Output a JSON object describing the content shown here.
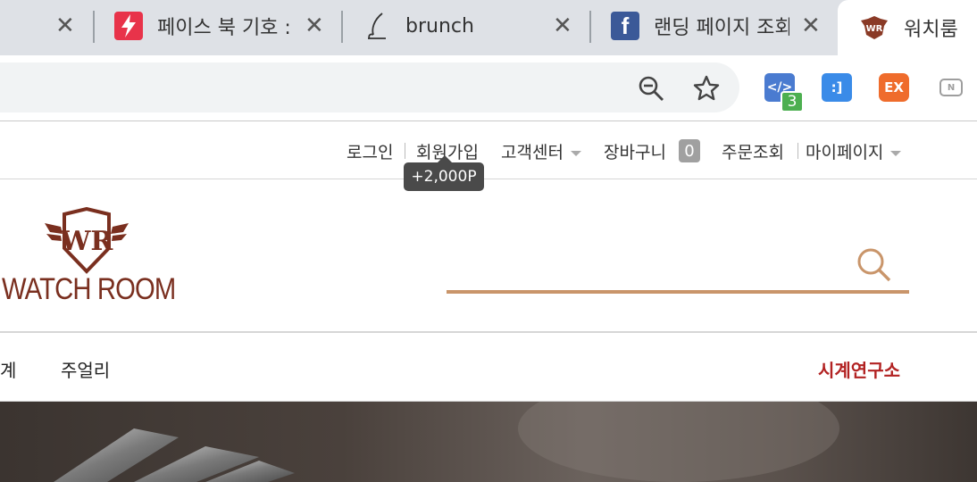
{
  "tabs": [
    {
      "title": "",
      "close": "✕"
    },
    {
      "title": "페이스 북 기호 :",
      "close": "✕",
      "favicon": "lightning-icon",
      "favicon_color": "#e8334a"
    },
    {
      "title": "brunch",
      "close": "✕",
      "favicon": "brunch-pen-icon"
    },
    {
      "title": "랜딩 페이지 조회",
      "close": "✕",
      "favicon": "facebook-icon",
      "favicon_color": "#3b5998"
    },
    {
      "title": "워치룸",
      "favicon": "watchroom-icon"
    }
  ],
  "toolbar": {
    "zoom_icon": "zoom-out-icon",
    "bookmark_icon": "star-icon",
    "extensions": [
      {
        "name": "code-extension-icon",
        "color": "#4a7bd0",
        "label": "</>",
        "badge": "3"
      },
      {
        "name": "tag-extension-icon",
        "color": "#3a8be8",
        "label": ":]"
      },
      {
        "name": "ex-extension-icon",
        "color": "#ef6c2c",
        "label": "EX"
      },
      {
        "name": "n-extension-icon",
        "color": "#9e9e9e",
        "label": "N"
      }
    ]
  },
  "util_nav": {
    "login": "로그인",
    "join": "회원가입",
    "customer_center": "고객센터",
    "cart": "장바구니",
    "cart_count": "0",
    "order_lookup": "주문조회",
    "mypage": "마이페이지",
    "join_tooltip": "+2,000P"
  },
  "header": {
    "logo_text": "WATCH ROOM",
    "logo_emblem": "WR",
    "accent_color": "#c9956a",
    "brand_color": "#7a2f1f"
  },
  "gnb": {
    "partial_item": "계",
    "jewelry": "주얼리",
    "lab": "시계연구소",
    "lab_color": "#b22222"
  }
}
